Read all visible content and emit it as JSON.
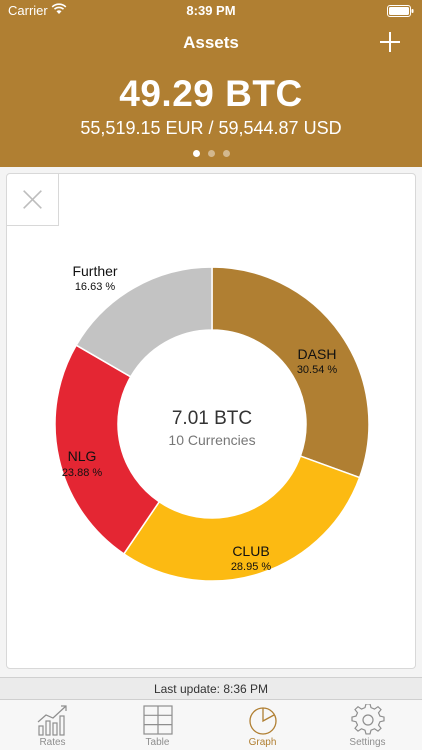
{
  "status_bar": {
    "carrier": "Carrier",
    "time": "8:39 PM"
  },
  "header": {
    "title": "Assets",
    "total_btc": "49.29 BTC",
    "fiat": "55,519.15 EUR / 59,544.87 USD",
    "pages": 3,
    "active_page": 1
  },
  "colors": {
    "brand": "#b07f32",
    "dash": "#b07f32",
    "club": "#fcba12",
    "nlg": "#e42633",
    "further": "#c3c3c3"
  },
  "chart_data": {
    "type": "pie",
    "center_value": "7.01 BTC",
    "center_label": "10 Currencies",
    "segments": [
      {
        "name": "DASH",
        "label": "30.54 %",
        "value": 30.54
      },
      {
        "name": "CLUB",
        "label": "28.95 %",
        "value": 28.95
      },
      {
        "name": "NLG",
        "label": "23.88 %",
        "value": 23.88
      },
      {
        "name": "Further",
        "label": "16.63 %",
        "value": 16.63
      }
    ]
  },
  "footer": {
    "last_update": "Last update: 8:36 PM"
  },
  "tabs": [
    {
      "label": "Rates",
      "icon": "chart-icon"
    },
    {
      "label": "Table",
      "icon": "table-icon"
    },
    {
      "label": "Graph",
      "icon": "pie-chart-icon",
      "active": true
    },
    {
      "label": "Settings",
      "icon": "gear-icon"
    }
  ]
}
